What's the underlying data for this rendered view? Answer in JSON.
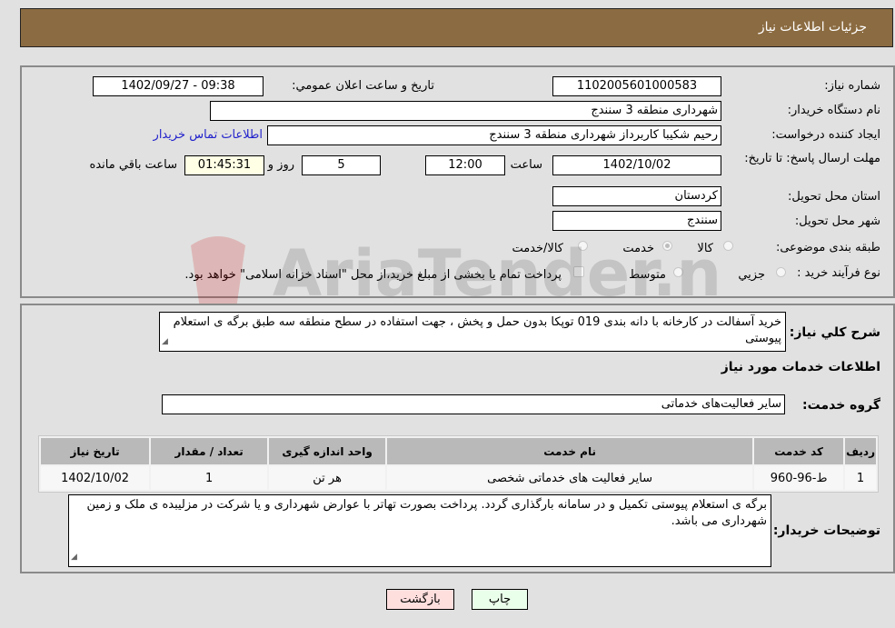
{
  "header": {
    "title": "جزئیات اطلاعات نیاز"
  },
  "details": {
    "need_number_label": "شماره نیاز:",
    "need_number": "1102005601000583",
    "announce_label": "تاریخ و ساعت اعلان عمومي:",
    "announce_value": "1402/09/27 - 09:38",
    "buyer_org_label": "نام دستگاه خریدار:",
    "buyer_org": "شهرداری منطقه 3 سنندج",
    "creator_label": "ایجاد کننده درخواست:",
    "creator": "رحیم شکیبا کاربرداز شهرداری منطقه 3 سنندج",
    "contact_link": "اطلاعات تماس خریدار",
    "deadline_label": "مهلت ارسال پاسخ: تا تاریخ:",
    "deadline_date": "1402/10/02",
    "time_label": "ساعت",
    "deadline_time": "12:00",
    "days_value": "5",
    "days_label": "روز و",
    "remaining_time": "01:45:31",
    "remaining_label": "ساعت باقي مانده",
    "province_label": "استان محل تحویل:",
    "province": "کردستان",
    "city_label": "شهر محل تحویل:",
    "city": "سنندج",
    "category_label": "طبقه بندی موضوعی:",
    "category_options": [
      {
        "label": "کالا",
        "selected": false
      },
      {
        "label": "خدمت",
        "selected": true
      },
      {
        "label": "کالا/خدمت",
        "selected": false
      }
    ],
    "process_label": "نوع فرآیند خرید :",
    "process_options": [
      {
        "label": "جزیي",
        "selected": false
      },
      {
        "label": "متوسط",
        "selected": false
      }
    ],
    "payment_note": "پرداخت تمام یا بخشی از مبلغ خرید،از محل \"اسناد خزانه اسلامی\" خواهد بود."
  },
  "needs": {
    "summary_label": "شرح کلي نیاز:",
    "summary": "خرید  آسفالت در کارخانه با دانه بندی 019 توپکا بدون حمل و پخش ، جهت استفاده در سطح منطقه سه طبق برگه ی استعلام پیوستی",
    "services_title": "اطلاعات خدمات مورد نیاز",
    "service_group_label": "گروه خدمت:",
    "service_group": "سایر فعالیت‌های خدماتی",
    "table": {
      "headers": [
        "ردیف",
        "کد خدمت",
        "نام خدمت",
        "واحد اندازه گیری",
        "تعداد / مقدار",
        "تاریخ نیاز"
      ],
      "rows": [
        [
          "1",
          "ط-96-960",
          "سایر فعالیت های خدماتی شخصی",
          "هر تن",
          "1",
          "1402/10/02"
        ]
      ]
    },
    "buyer_notes_label": "توضیحات خریدار:",
    "buyer_notes": "برگه ی استعلام پیوستی تکمیل و در سامانه بارگذاری گردد. پرداخت بصورت تهاتر با عوارض شهرداری و  یا شرکت در مزلیبده ی ملک و زمین شهرداری می باشد."
  },
  "buttons": {
    "print": "چاپ",
    "back": "بازگشت"
  },
  "watermark": "AriaTender.net",
  "colors": {
    "header_bg": "#8b6b41",
    "print_bg": "#eaffea",
    "back_bg": "#ffdede",
    "link": "#2222cc"
  }
}
